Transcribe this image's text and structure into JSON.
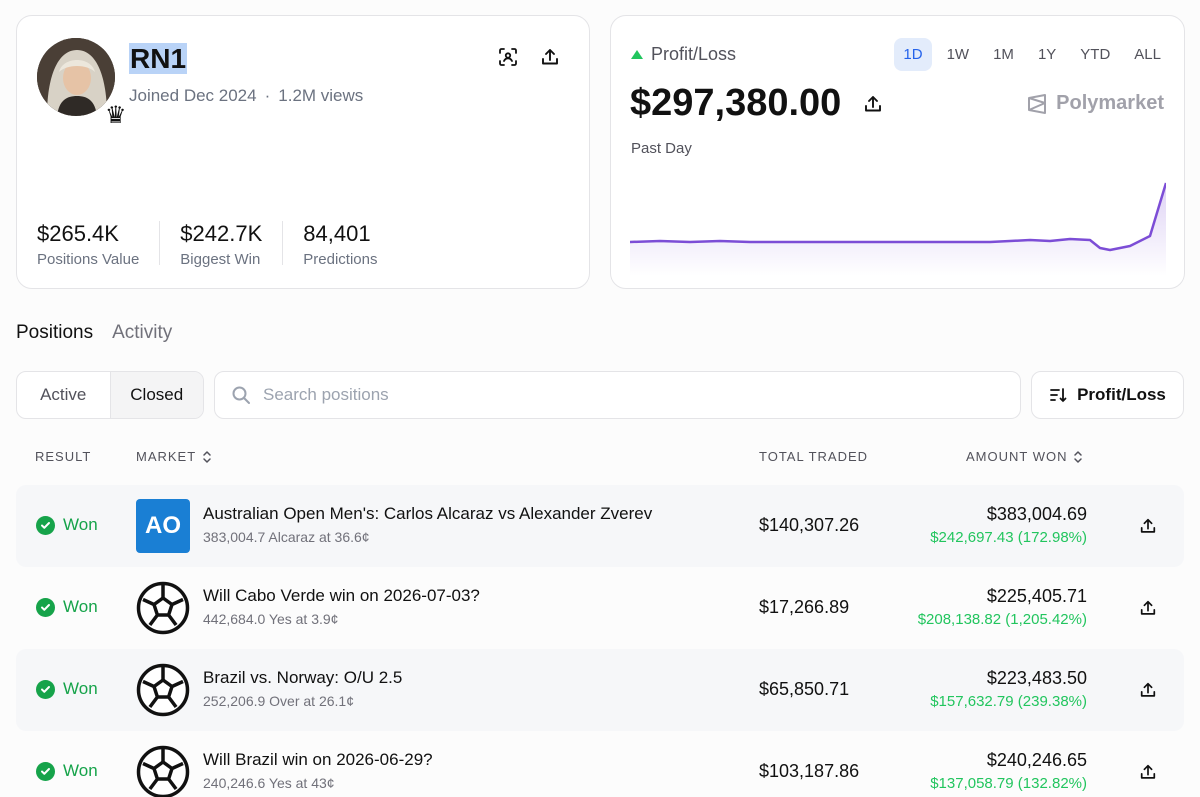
{
  "profile": {
    "username": "RN1",
    "joined": "Joined Dec 2024",
    "separator": "·",
    "views": "1.2M views",
    "stats": [
      {
        "value": "$265.4K",
        "label": "Positions Value"
      },
      {
        "value": "$242.7K",
        "label": "Biggest Win"
      },
      {
        "value": "84,401",
        "label": "Predictions"
      }
    ]
  },
  "pnl": {
    "label": "Profit/Loss",
    "value": "$297,380.00",
    "period": "Past Day",
    "brand": "Polymarket",
    "ranges": [
      "1D",
      "1W",
      "1M",
      "1Y",
      "YTD",
      "ALL"
    ],
    "active_range": "1D",
    "accent": "#7c4dd6"
  },
  "tabs": {
    "positions": "Positions",
    "activity": "Activity"
  },
  "filters": {
    "active": "Active",
    "closed": "Closed",
    "search_placeholder": "Search positions",
    "sort_label": "Profit/Loss"
  },
  "table": {
    "headers": {
      "result": "RESULT",
      "market": "MARKET",
      "total_traded": "TOTAL TRADED",
      "amount_won": "AMOUNT WON"
    },
    "rows": [
      {
        "result": "Won",
        "title": "Australian Open Men's: Carlos Alcaraz vs Alexander Zverev",
        "sub": "383,004.7 Alcaraz at 36.6¢",
        "traded": "$140,307.26",
        "won": "$383,004.69",
        "gain": "$242,697.43 (172.98%)",
        "thumb": "AO"
      },
      {
        "result": "Won",
        "title": "Will Cabo Verde win on 2026-07-03?",
        "sub": "442,684.0 Yes at 3.9¢",
        "traded": "$17,266.89",
        "won": "$225,405.71",
        "gain": "$208,138.82 (1,205.42%)"
      },
      {
        "result": "Won",
        "title": "Brazil vs. Norway: O/U 2.5",
        "sub": "252,206.9 Over at 26.1¢",
        "traded": "$65,850.71",
        "won": "$223,483.50",
        "gain": "$157,632.79 (239.38%)"
      },
      {
        "result": "Won",
        "title": "Will Brazil win on 2026-06-29?",
        "sub": "240,246.6 Yes at 43¢",
        "traded": "$103,187.86",
        "won": "$240,246.65",
        "gain": "$137,058.79 (132.82%)"
      }
    ]
  },
  "colors": {
    "won_green": "#16a34a",
    "gain_green": "#22c55e",
    "active_blue": "#2563eb",
    "chart_line": "#7c4dd6"
  }
}
